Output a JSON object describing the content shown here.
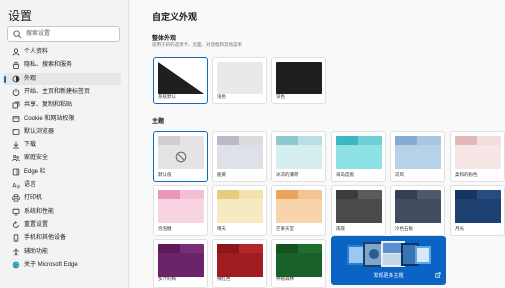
{
  "sidebar": {
    "title": "设置",
    "search_placeholder": "搜索设置",
    "items": [
      {
        "label": "个人资料",
        "icon": "person-icon"
      },
      {
        "label": "隐私、搜索和服务",
        "icon": "lock-icon"
      },
      {
        "label": "外观",
        "icon": "appearance-icon",
        "active": true
      },
      {
        "label": "开始、主页和新建标签页",
        "icon": "power-icon"
      },
      {
        "label": "共享、复制和粘贴",
        "icon": "share-icon"
      },
      {
        "label": "Cookie 和网站权限",
        "icon": "cookie-icon"
      },
      {
        "label": "默认浏览器",
        "icon": "browser-icon"
      },
      {
        "label": "下载",
        "icon": "download-icon"
      },
      {
        "label": "家庭安全",
        "icon": "family-icon"
      },
      {
        "label": "Edge 栏",
        "icon": "edge-bar-icon"
      },
      {
        "label": "语言",
        "icon": "language-icon"
      },
      {
        "label": "打印机",
        "icon": "printer-icon"
      },
      {
        "label": "系统和性能",
        "icon": "system-icon"
      },
      {
        "label": "重置设置",
        "icon": "reset-icon"
      },
      {
        "label": "手机和其他设备",
        "icon": "phone-icon"
      },
      {
        "label": "辅助功能",
        "icon": "accessibility-icon"
      },
      {
        "label": "关于 Microsoft Edge",
        "icon": "edge-logo-icon"
      }
    ]
  },
  "main": {
    "title": "自定义外观",
    "overall": {
      "heading": "整体外观",
      "subtitle": "适用于新的选项卡、页面、对话框和其他菜单",
      "options": [
        {
          "label": "系统默认",
          "selected": true
        },
        {
          "label": "浅色"
        },
        {
          "label": "深色"
        }
      ]
    },
    "themes": {
      "heading": "主题",
      "items": [
        {
          "label": "默认值",
          "selected": true,
          "top": "#e4e4e4",
          "tab": "#cfcfcf",
          "body": "#e4e4e4",
          "default": true
        },
        {
          "label": "鹿黄",
          "top": "#dcdcdc",
          "tab": "#b9bcc6",
          "body": "#dfe1e8"
        },
        {
          "label": "冰凉的薄荷",
          "top": "#b8e0e4",
          "tab": "#8cc9d0",
          "body": "#d5eff1"
        },
        {
          "label": "海岛度假",
          "top": "#6fcfd6",
          "tab": "#3db7c1",
          "body": "#8ee1e5"
        },
        {
          "label": "凉风",
          "top": "#a9c6e0",
          "tab": "#85abd0",
          "body": "#b7d1e8"
        },
        {
          "label": "柔和的粉色",
          "top": "#f2dcdc",
          "tab": "#e3b7b7",
          "body": "#f6e6e6"
        },
        {
          "label": "泡泡糖",
          "top": "#f4bfd4",
          "tab": "#ea98b8",
          "body": "#f8d3e2"
        },
        {
          "label": "晴天",
          "top": "#f2e2ad",
          "tab": "#e4cd7f",
          "body": "#f6eac3"
        },
        {
          "label": "芒果天堂",
          "top": "#f4c38f",
          "tab": "#eba360",
          "body": "#f8d4ab"
        },
        {
          "label": "雨夜",
          "top": "#5b5b5b",
          "tab": "#3c3c3c",
          "body": "#4a4a4a"
        },
        {
          "label": "冷色石板",
          "top": "#4e5a6c",
          "tab": "#333f52",
          "body": "#414c5e"
        },
        {
          "label": "月光",
          "top": "#264c80",
          "tab": "#163563",
          "body": "#1e4171"
        },
        {
          "label": "多汁的梅",
          "top": "#7b2e78",
          "tab": "#5d1b5b",
          "body": "#6b246a"
        },
        {
          "label": "辣红色",
          "top": "#b3262b",
          "tab": "#8c1519",
          "body": "#a01c21"
        },
        {
          "label": "神秘森林",
          "top": "#1f6e2e",
          "tab": "#135220",
          "body": "#186128"
        }
      ]
    },
    "discover_label": "发现更多主题"
  },
  "colors": {
    "accent": "#0f6cbd",
    "discover_bg": "#0b64c4"
  }
}
